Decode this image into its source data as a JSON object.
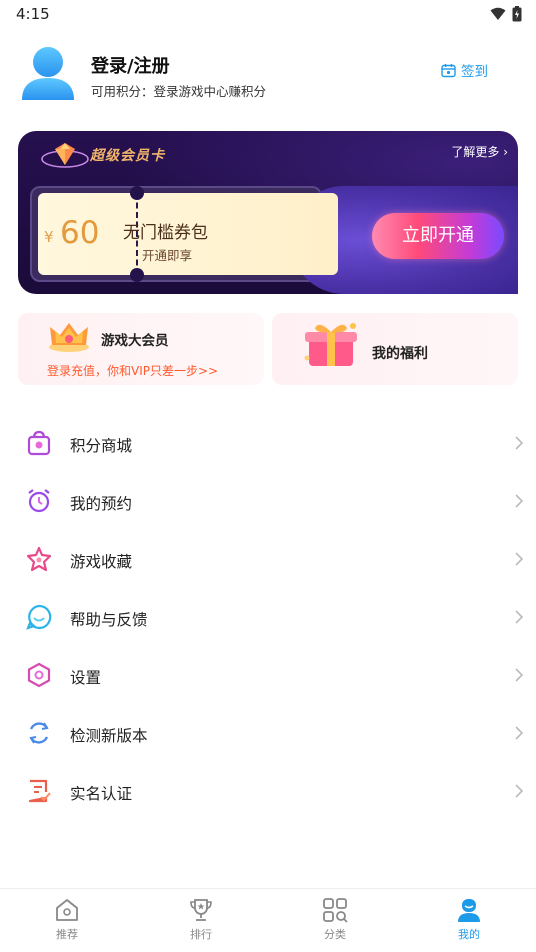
{
  "status_bar": {
    "time": "4:15"
  },
  "profile": {
    "login_label": "登录/注册",
    "points_label": "可用积分：",
    "points_hint": "登录游戏中心赚积分",
    "checkin_label": "签到"
  },
  "vip_card": {
    "title": "超级会员卡",
    "more_label": "了解更多",
    "coupon_currency": "¥",
    "coupon_amount": "60",
    "coupon_name": "无门槛券包",
    "coupon_sub": "开通即享",
    "open_button": "立即开通"
  },
  "tiles": {
    "member_title": "游戏大会员",
    "member_sub": "登录充值，你和VIP只差一步>>",
    "welfare_title": "我的福利"
  },
  "menu": [
    {
      "label": "积分商城",
      "icon": "shopping-bag-icon"
    },
    {
      "label": "我的预约",
      "icon": "alarm-clock-icon"
    },
    {
      "label": "游戏收藏",
      "icon": "star-icon"
    },
    {
      "label": "帮助与反馈",
      "icon": "chat-bubble-icon"
    },
    {
      "label": "设置",
      "icon": "hexagon-settings-icon"
    },
    {
      "label": "检测新版本",
      "icon": "refresh-icon"
    },
    {
      "label": "实名认证",
      "icon": "id-document-icon"
    }
  ],
  "bottom_nav": [
    {
      "label": "推荐",
      "icon": "home-icon",
      "active": false
    },
    {
      "label": "排行",
      "icon": "trophy-icon",
      "active": false
    },
    {
      "label": "分类",
      "icon": "category-grid-icon",
      "active": false
    },
    {
      "label": "我的",
      "icon": "user-icon",
      "active": true
    }
  ],
  "colors": {
    "accent": "#1e9be8",
    "vip_gold": "#f0b46a",
    "promo_orange": "#ff5a2c"
  }
}
